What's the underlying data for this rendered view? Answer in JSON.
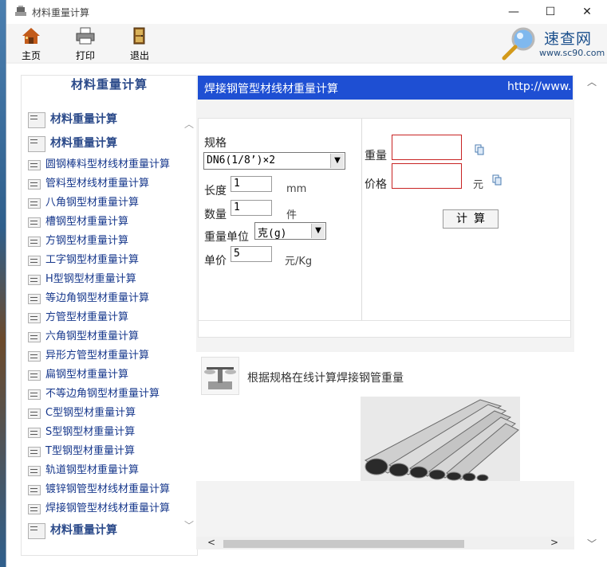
{
  "window": {
    "title": "材料重量计算",
    "minimize": "—",
    "maximize": "☐",
    "close": "✕"
  },
  "toolbar": {
    "home": "主页",
    "print": "打印",
    "exit": "退出"
  },
  "logo": {
    "name": "速查网",
    "url": "www.sc90.com"
  },
  "sidebar": {
    "title": "材料重量计算",
    "scroll_up": "︿",
    "scroll_down": "﹀",
    "items": [
      {
        "label": "材料重量计算",
        "head": true
      },
      {
        "label": "材料重量计算",
        "head": true
      },
      {
        "label": "圆钢棒料型材线材重量计算",
        "head": false
      },
      {
        "label": "管料型材线材重量计算",
        "head": false
      },
      {
        "label": "八角钢型材重量计算",
        "head": false
      },
      {
        "label": "槽钢型材重量计算",
        "head": false
      },
      {
        "label": "方钢型材重量计算",
        "head": false
      },
      {
        "label": "工字钢型材重量计算",
        "head": false
      },
      {
        "label": "H型钢型材重量计算",
        "head": false
      },
      {
        "label": "等边角钢型材重量计算",
        "head": false
      },
      {
        "label": "方管型材重量计算",
        "head": false
      },
      {
        "label": "六角钢型材重量计算",
        "head": false
      },
      {
        "label": "异形方管型材重量计算",
        "head": false
      },
      {
        "label": "扁钢型材重量计算",
        "head": false
      },
      {
        "label": "不等边角钢型材重量计算",
        "head": false
      },
      {
        "label": "C型钢型材重量计算",
        "head": false
      },
      {
        "label": "S型钢型材重量计算",
        "head": false
      },
      {
        "label": "T型钢型材重量计算",
        "head": false
      },
      {
        "label": "轨道钢型材重量计算",
        "head": false
      },
      {
        "label": "镀锌钢管型材线材重量计算",
        "head": false
      },
      {
        "label": "焊接钢管型材线材重量计算",
        "head": false
      },
      {
        "label": "材料重量计算",
        "head": true
      }
    ]
  },
  "main": {
    "banner_title": "焊接钢管型材线材重量计算",
    "banner_link": "http://www.",
    "form": {
      "spec_label": "规格",
      "spec_value": "DN6(1/8’)×2",
      "length_label": "长度",
      "length_value": "1",
      "length_unit": "mm",
      "qty_label": "数量",
      "qty_value": "1",
      "qty_unit": "件",
      "weight_unit_label": "重量单位",
      "weight_unit_value": "克(g)",
      "price_label": "单价",
      "price_value": "5",
      "price_unit": "元/Kg",
      "weight_label": "重量",
      "weight_value": "",
      "cost_label": "价格",
      "cost_value": "",
      "cost_unit": "元",
      "calc_button": "计算"
    },
    "description": "根据规格在线计算焊接钢管重量"
  },
  "scroll": {
    "left": "<",
    "right": ">",
    "up": "︿",
    "down": "﹀"
  }
}
